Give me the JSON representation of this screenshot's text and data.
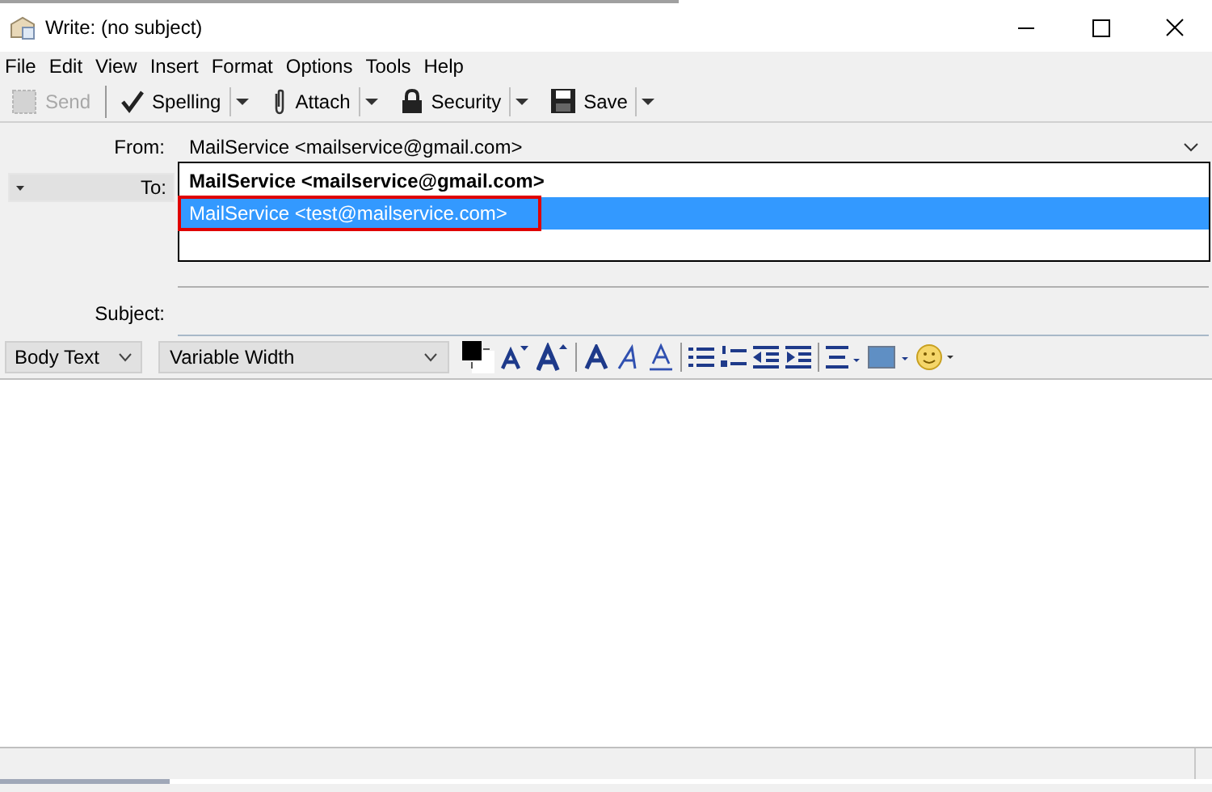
{
  "window": {
    "title": "Write: (no subject)"
  },
  "menu": [
    "File",
    "Edit",
    "View",
    "Insert",
    "Format",
    "Options",
    "Tools",
    "Help"
  ],
  "toolbar": [
    {
      "label": "Send",
      "disabled": true,
      "dropdown": false
    },
    {
      "label": "Spelling",
      "disabled": false,
      "dropdown": true
    },
    {
      "label": "Attach",
      "disabled": false,
      "dropdown": true
    },
    {
      "label": "Security",
      "disabled": false,
      "dropdown": true
    },
    {
      "label": "Save",
      "disabled": false,
      "dropdown": true
    }
  ],
  "from": {
    "label": "From:",
    "value": "MailService <mailservice@gmail.com>"
  },
  "to": {
    "label": "To:"
  },
  "suggestions": [
    {
      "text": "MailService <mailservice@gmail.com>",
      "bold": true,
      "selected": false
    },
    {
      "text": "MailService <test@mailservice.com>",
      "bold": false,
      "selected": true
    }
  ],
  "subject": {
    "label": "Subject:"
  },
  "format": {
    "paragraph": "Body Text",
    "font": "Variable Width"
  }
}
